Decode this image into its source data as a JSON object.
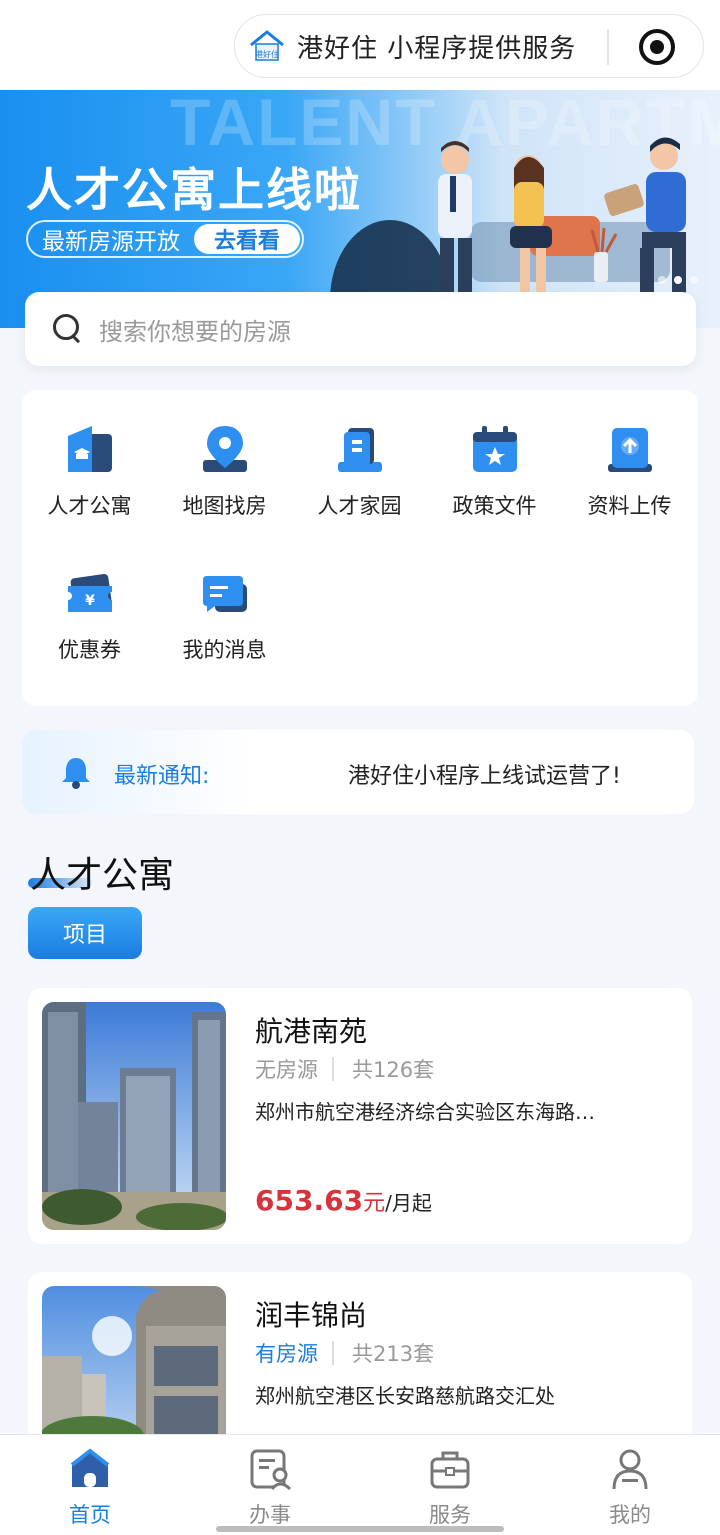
{
  "capsule": {
    "title": "港好住 小程序提供服务",
    "logo_text": "港好住"
  },
  "banner": {
    "bg_text": "TALENT APARTMENT",
    "title": "人才公寓上线啦",
    "pill_text": "最新房源开放",
    "pill_button": "去看看"
  },
  "search": {
    "placeholder": "搜索你想要的房源"
  },
  "menu": {
    "items": [
      {
        "label": "人才公寓",
        "icon": "apartment-icon"
      },
      {
        "label": "地图找房",
        "icon": "map-pin-icon"
      },
      {
        "label": "人才家园",
        "icon": "building-icon"
      },
      {
        "label": "政策文件",
        "icon": "calendar-star-icon"
      },
      {
        "label": "资料上传",
        "icon": "upload-icon"
      },
      {
        "label": "优惠券",
        "icon": "coupon-icon"
      },
      {
        "label": "我的消息",
        "icon": "message-icon"
      }
    ]
  },
  "notice": {
    "label": "最新通知:",
    "text": "港好住小程序上线试运营了!"
  },
  "section": {
    "title": "人才公寓",
    "chip": "项目"
  },
  "listings": [
    {
      "name": "航港南苑",
      "status": "无房源",
      "total": "共126套",
      "address": "郑州市航空港经济综合实验区东海路…",
      "price": "653.63",
      "price_unit": "元",
      "price_suffix": "/月起"
    },
    {
      "name": "润丰锦尚",
      "status": "有房源",
      "total": "共213套",
      "address": "郑州航空港区长安路慈航路交汇处"
    }
  ],
  "tabbar": {
    "tabs": [
      {
        "label": "首页",
        "icon": "home-icon",
        "active": true
      },
      {
        "label": "办事",
        "icon": "service-doc-icon",
        "active": false
      },
      {
        "label": "服务",
        "icon": "briefcase-icon",
        "active": false
      },
      {
        "label": "我的",
        "icon": "user-icon",
        "active": false
      }
    ]
  },
  "colors": {
    "accent": "#1a7de0",
    "price": "#d8333a"
  }
}
